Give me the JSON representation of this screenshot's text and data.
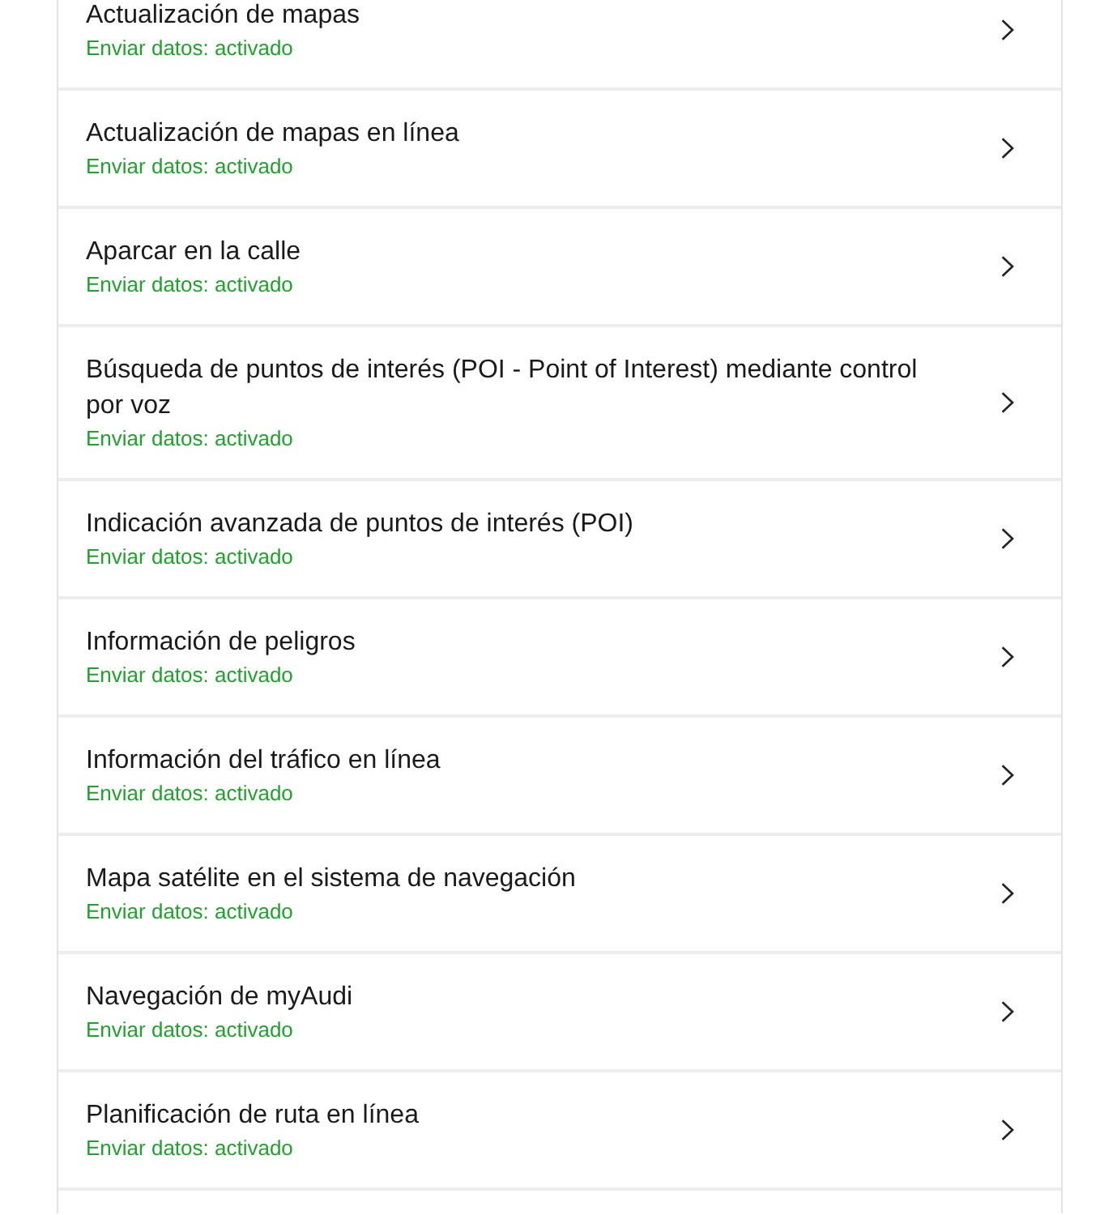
{
  "items": [
    {
      "title": "Actualización de mapas",
      "subtitle": "Enviar datos: activado"
    },
    {
      "title": "Actualización de mapas en línea",
      "subtitle": "Enviar datos: activado"
    },
    {
      "title": "Aparcar en la calle",
      "subtitle": "Enviar datos: activado"
    },
    {
      "title": "Búsqueda de puntos de interés (POI - Point of Interest) mediante control por voz",
      "subtitle": "Enviar datos: activado"
    },
    {
      "title": "Indicación avanzada de puntos de interés (POI)",
      "subtitle": "Enviar datos: activado"
    },
    {
      "title": "Información de peligros",
      "subtitle": "Enviar datos: activado"
    },
    {
      "title": "Información del tráfico en línea",
      "subtitle": "Enviar datos: activado"
    },
    {
      "title": "Mapa satélite en el sistema de navegación",
      "subtitle": "Enviar datos: activado"
    },
    {
      "title": "Navegación de myAudi",
      "subtitle": "Enviar datos: activado"
    },
    {
      "title": "Planificación de ruta en línea",
      "subtitle": "Enviar datos: activado"
    }
  ]
}
